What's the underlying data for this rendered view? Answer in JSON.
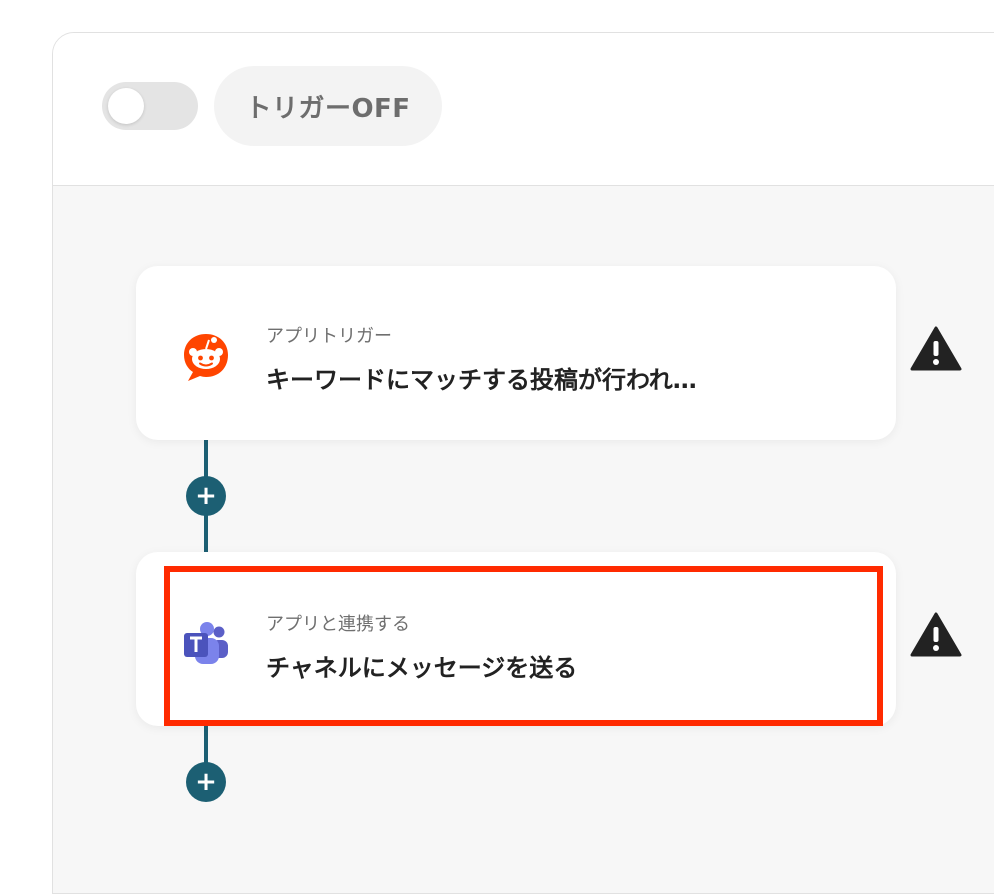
{
  "header": {
    "trigger_toggle_state": "off",
    "trigger_status_label": "トリガーOFF"
  },
  "flow": {
    "steps": [
      {
        "app_icon": "reddit-icon",
        "category": "アプリトリガー",
        "title": "キーワードにマッチする投稿が行われ…",
        "warning_icon": "warning-icon"
      },
      {
        "app_icon": "microsoft-teams-icon",
        "category": "アプリと連携する",
        "title": "チャネルにメッセージを送る",
        "warning_icon": "warning-icon",
        "highlighted": true
      }
    ],
    "add_step_glyph": "+"
  },
  "colors": {
    "connector": "#1c5f73",
    "highlight_border": "#ff2a00",
    "reddit": "#ff4500",
    "teams": "#5b5fc7",
    "toggle_off": "#e4e4e4"
  }
}
